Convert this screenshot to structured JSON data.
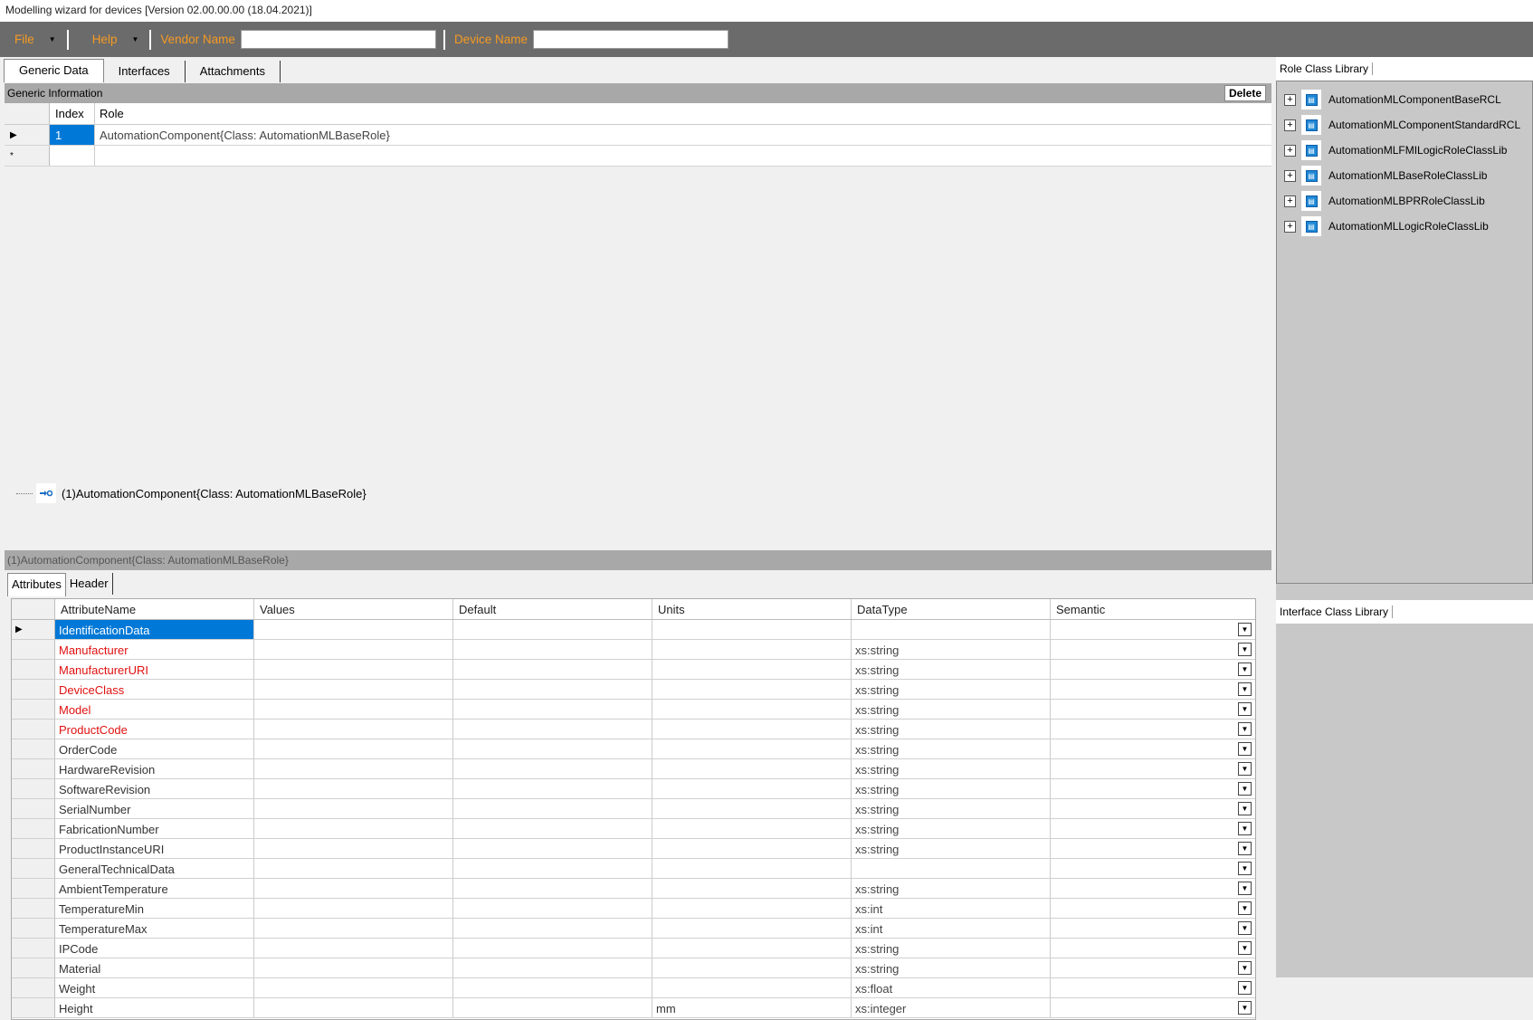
{
  "window": {
    "title": "Modelling wizard for devices [Version 02.00.00.00 (18.04.2021)]"
  },
  "menu": {
    "file": "File",
    "help": "Help",
    "vendor_label": "Vendor Name",
    "device_label": "Device Name",
    "vendor_value": "",
    "device_value": ""
  },
  "tabs": [
    "Generic Data",
    "Interfaces",
    "Attachments"
  ],
  "generic_info": {
    "header": "Generic Information",
    "delete": "Delete",
    "columns": {
      "index": "Index",
      "role": "Role"
    },
    "rows": [
      {
        "index": "1",
        "role": "AutomationComponent{Class:  AutomationMLBaseRole}"
      }
    ],
    "new_row_marker": "*",
    "selected_marker": "▶"
  },
  "tree": {
    "node": "(1)AutomationComponent{Class:  AutomationMLBaseRole}"
  },
  "component": {
    "header": "(1)AutomationComponent{Class:  AutomationMLBaseRole}"
  },
  "subtabs": [
    "Attributes",
    "Header"
  ],
  "attributes": {
    "columns": [
      "AttributeName",
      "Values",
      "Default",
      "Units",
      "DataType",
      "Semantic"
    ],
    "rows": [
      {
        "name": "IdentificationData",
        "units": "",
        "type": "",
        "required": false,
        "selected": true
      },
      {
        "name": "Manufacturer",
        "units": "",
        "type": "xs:string",
        "required": true
      },
      {
        "name": "ManufacturerURI",
        "units": "",
        "type": "xs:string",
        "required": true
      },
      {
        "name": "DeviceClass",
        "units": "",
        "type": "xs:string",
        "required": true
      },
      {
        "name": "Model",
        "units": "",
        "type": "xs:string",
        "required": true
      },
      {
        "name": "ProductCode",
        "units": "",
        "type": "xs:string",
        "required": true
      },
      {
        "name": "OrderCode",
        "units": "",
        "type": "xs:string",
        "required": false
      },
      {
        "name": "HardwareRevision",
        "units": "",
        "type": "xs:string",
        "required": false
      },
      {
        "name": "SoftwareRevision",
        "units": "",
        "type": "xs:string",
        "required": false
      },
      {
        "name": "SerialNumber",
        "units": "",
        "type": "xs:string",
        "required": false
      },
      {
        "name": "FabricationNumber",
        "units": "",
        "type": "xs:string",
        "required": false
      },
      {
        "name": "ProductInstanceURI",
        "units": "",
        "type": "xs:string",
        "required": false
      },
      {
        "name": "GeneralTechnicalData",
        "units": "",
        "type": "",
        "required": false
      },
      {
        "name": "AmbientTemperature",
        "units": "",
        "type": "xs:string",
        "required": false
      },
      {
        "name": "TemperatureMin",
        "units": "",
        "type": "xs:int",
        "required": false
      },
      {
        "name": "TemperatureMax",
        "units": "",
        "type": "xs:int",
        "required": false
      },
      {
        "name": "IPCode",
        "units": "",
        "type": "xs:string",
        "required": false
      },
      {
        "name": "Material",
        "units": "",
        "type": "xs:string",
        "required": false
      },
      {
        "name": "Weight",
        "units": "",
        "type": "xs:float",
        "required": false
      },
      {
        "name": "Height",
        "units": "mm",
        "type": "xs:integer",
        "required": false
      }
    ]
  },
  "role_class_library": {
    "title": "Role Class Library",
    "items": [
      "AutomationMLComponentBaseRCL",
      "AutomationMLComponentStandardRCL",
      "AutomationMLFMILogicRoleClassLib",
      "AutomationMLBaseRoleClassLib",
      "AutomationMLBPRRoleClassLib",
      "AutomationMLLogicRoleClassLib"
    ]
  },
  "interface_class_library": {
    "title": "Interface Class Library"
  },
  "colors": {
    "menubar": "#6b6b6b",
    "menu_text": "#f59a23",
    "required": "#e01010",
    "selection": "#0078d7"
  }
}
